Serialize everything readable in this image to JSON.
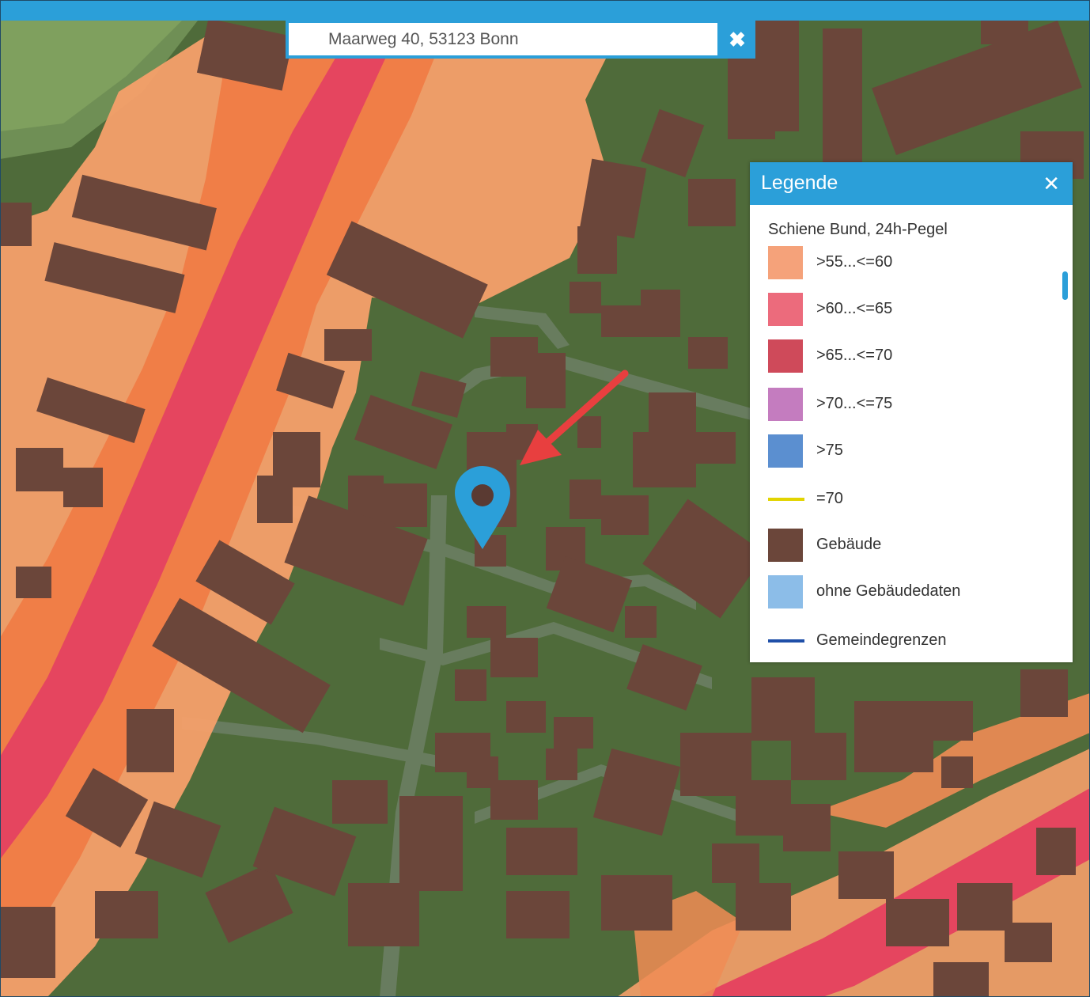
{
  "search": {
    "value": "Maarweg 40, 53123 Bonn",
    "clear_icon": "close-icon"
  },
  "legend": {
    "title": "Legende",
    "close_icon": "close-icon",
    "subtitle": "Schiene Bund, 24h-Pegel",
    "items": [
      {
        "label": ">55...<=60",
        "color": "#f5a27a",
        "kind": "fill"
      },
      {
        "label": ">60...<=65",
        "color": "#ec6b7c",
        "kind": "fill"
      },
      {
        "label": ">65...<=70",
        "color": "#cf4a5a",
        "kind": "fill"
      },
      {
        "label": ">70...<=75",
        "color": "#c47cbf",
        "kind": "fill"
      },
      {
        "label": ">75",
        "color": "#5b8fd0",
        "kind": "fill"
      },
      {
        "label": "=70",
        "color": "#e2d400",
        "kind": "line"
      },
      {
        "label": "Gebäude",
        "color": "#6b463a",
        "kind": "fill"
      },
      {
        "label": "ohne Gebäudedaten",
        "color": "#8cbde8",
        "kind": "fill"
      },
      {
        "label": "Gemeindegrenzen",
        "color": "#1f4fa8",
        "kind": "line"
      }
    ]
  },
  "map": {
    "marker_icon": "location-pin-icon",
    "arrow_icon": "arrow-annotation-icon",
    "colors": {
      "aerial": "#4f6b3a",
      "noise_outer": "#f5a06a",
      "noise_mid": "#f07e47",
      "noise_core": "#e5455f",
      "building": "#6b463a",
      "marker": "#2b9fd9",
      "arrow": "#e83f3f"
    }
  }
}
